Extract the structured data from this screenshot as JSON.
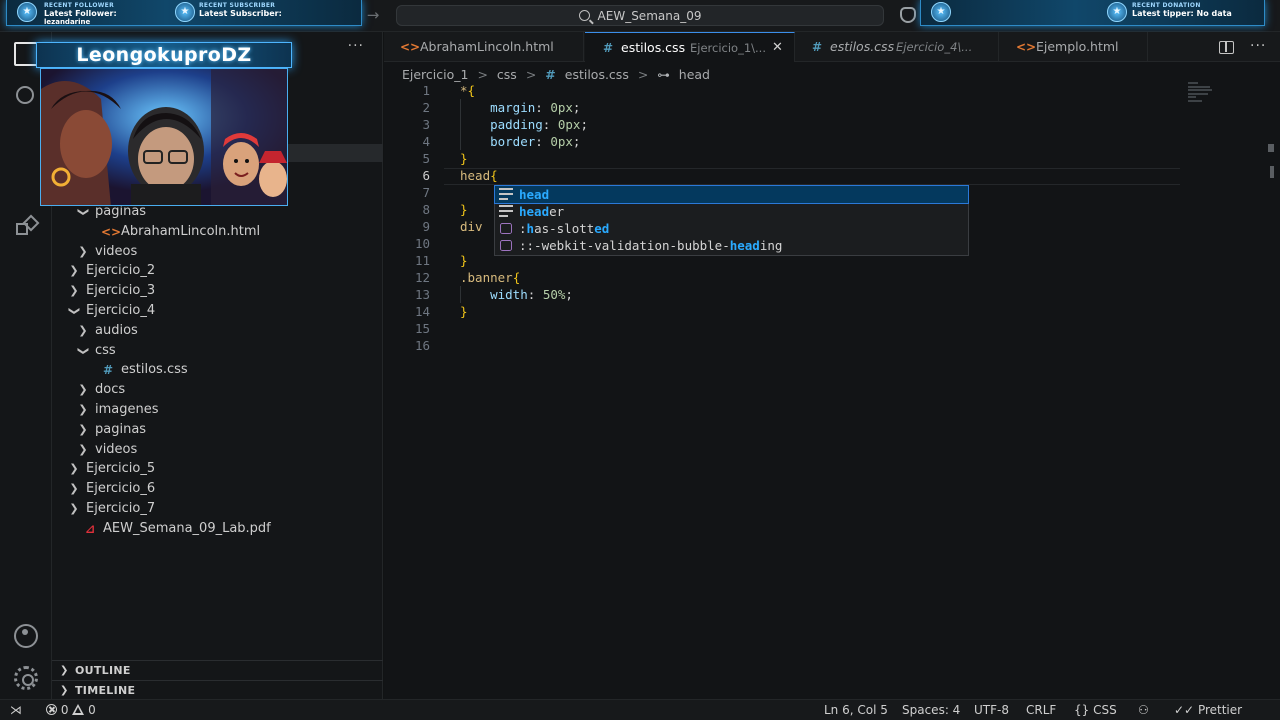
{
  "titlebar": {
    "nav_forward_glyph": "→",
    "search_text": "AEW_Semana_09",
    "search_icon": "search-icon",
    "copilot_icon": "copilot-icon"
  },
  "stream_overlay": {
    "follower": {
      "small": "RECENT FOLLOWER",
      "big": "Latest Follower:",
      "extra": "lezandarine"
    },
    "subscriber": {
      "small": "RECENT SUBSCRIBER",
      "big": "Latest Subscriber:"
    },
    "donation": {
      "small": "RECENT DONATION",
      "big": "Latest tipper: No data"
    },
    "streamer_name": "LeongokuproDZ",
    "badge_glyph": "★",
    "accent_color": "#2e8bc7"
  },
  "activity_bar": {
    "icons": [
      "explorer-icon",
      "search-icon",
      "extensions-icon",
      "account-icon",
      "settings-icon"
    ]
  },
  "sidebar": {
    "more_glyph": "···",
    "tree": [
      {
        "label": "paginas",
        "type": "folder",
        "expanded": true,
        "depth": 2
      },
      {
        "label": "AbrahamLincoln.html",
        "type": "html",
        "depth": 3,
        "icon": "<>"
      },
      {
        "label": "videos",
        "type": "folder",
        "expanded": false,
        "depth": 2
      },
      {
        "label": "Ejercicio_2",
        "type": "folder",
        "expanded": false,
        "depth": 1
      },
      {
        "label": "Ejercicio_3",
        "type": "folder",
        "expanded": false,
        "depth": 1
      },
      {
        "label": "Ejercicio_4",
        "type": "folder",
        "expanded": true,
        "depth": 1
      },
      {
        "label": "audios",
        "type": "folder",
        "expanded": false,
        "depth": 2
      },
      {
        "label": "css",
        "type": "folder",
        "expanded": true,
        "depth": 2
      },
      {
        "label": "estilos.css",
        "type": "css",
        "depth": 3,
        "icon": "#"
      },
      {
        "label": "docs",
        "type": "folder",
        "expanded": false,
        "depth": 2
      },
      {
        "label": "imagenes",
        "type": "folder",
        "expanded": false,
        "depth": 2
      },
      {
        "label": "paginas",
        "type": "folder",
        "expanded": false,
        "depth": 2
      },
      {
        "label": "videos",
        "type": "folder",
        "expanded": false,
        "depth": 2
      },
      {
        "label": "Ejercicio_5",
        "type": "folder",
        "expanded": false,
        "depth": 1
      },
      {
        "label": "Ejercicio_6",
        "type": "folder",
        "expanded": false,
        "depth": 1
      },
      {
        "label": "Ejercicio_7",
        "type": "folder",
        "expanded": false,
        "depth": 1
      },
      {
        "label": "AEW_Semana_09_Lab.pdf",
        "type": "pdf",
        "depth": 1,
        "icon": "⊿"
      }
    ],
    "outline_label": "OUTLINE",
    "timeline_label": "TIMELINE"
  },
  "tabs": [
    {
      "icon": "<>",
      "label": "AbrahamLincoln.html",
      "desc": "",
      "active": false,
      "italic": false
    },
    {
      "icon": "#",
      "label": "estilos.css",
      "desc": "Ejercicio_1\\...",
      "active": true,
      "italic": false
    },
    {
      "icon": "#",
      "label": "estilos.css",
      "desc": "Ejercicio_4\\...",
      "active": false,
      "italic": true
    },
    {
      "icon": "<>",
      "label": "Ejemplo.html",
      "desc": "",
      "active": false,
      "italic": false
    }
  ],
  "tab_close_glyph": "✕",
  "breadcrumb": {
    "parts": [
      "Ejercicio_1",
      "css",
      "estilos.css",
      "head"
    ],
    "separator": ">"
  },
  "editor": {
    "current_line": 6,
    "lines": [
      [
        [
          "sel",
          "*"
        ],
        [
          "brace",
          "{"
        ]
      ],
      [
        [
          "plain",
          "    "
        ],
        [
          "prop",
          "margin"
        ],
        [
          "plain",
          ": "
        ],
        [
          "num",
          "0px"
        ],
        [
          "plain",
          ";"
        ]
      ],
      [
        [
          "plain",
          "    "
        ],
        [
          "prop",
          "padding"
        ],
        [
          "plain",
          ": "
        ],
        [
          "num",
          "0px"
        ],
        [
          "plain",
          ";"
        ]
      ],
      [
        [
          "plain",
          "    "
        ],
        [
          "prop",
          "border"
        ],
        [
          "plain",
          ": "
        ],
        [
          "num",
          "0px"
        ],
        [
          "plain",
          ";"
        ]
      ],
      [
        [
          "brace",
          "}"
        ]
      ],
      [
        [
          "sel",
          "head"
        ],
        [
          "brace",
          "{"
        ]
      ],
      [
        [
          "plain",
          ""
        ]
      ],
      [
        [
          "brace",
          "}"
        ]
      ],
      [
        [
          "sel",
          "div"
        ]
      ],
      [
        [
          "plain",
          ""
        ]
      ],
      [
        [
          "brace",
          "}"
        ]
      ],
      [
        [
          "sel",
          ".banner"
        ],
        [
          "brace",
          "{"
        ]
      ],
      [
        [
          "plain",
          "    "
        ],
        [
          "prop",
          "width"
        ],
        [
          "plain",
          ": "
        ],
        [
          "num",
          "50%"
        ],
        [
          "plain",
          ";"
        ]
      ],
      [
        [
          "brace",
          "}"
        ]
      ],
      [
        [
          "plain",
          ""
        ]
      ],
      [
        [
          "plain",
          ""
        ]
      ]
    ]
  },
  "suggestions": [
    {
      "icon": "keyword-icon",
      "match": "head",
      "rest": "",
      "prefix": "",
      "selected": true
    },
    {
      "icon": "keyword-icon",
      "match": "head",
      "rest": "er",
      "prefix": "",
      "selected": false
    },
    {
      "icon": "property-icon",
      "match": "",
      "rest": "",
      "prefix": ":has-slotted",
      "selected": false
    },
    {
      "icon": "property-icon",
      "match": "",
      "rest": "",
      "prefix": "::-webkit-validation-bubble-",
      "selected": false
    }
  ],
  "suggestion_extra": {
    "pre": "::-webkit-validation-bubble-",
    "match": "head",
    "post": "ing"
  },
  "statusbar": {
    "remote_glyph": "⋊",
    "errors": "0",
    "warnings": "0",
    "position": "Ln 6, Col 5",
    "spaces": "Spaces: 4",
    "encoding": "UTF-8",
    "eol": "CRLF",
    "language": "CSS",
    "language_glyph": "{}",
    "prettier": "Prettier",
    "prettier_glyph": "✓✓"
  }
}
